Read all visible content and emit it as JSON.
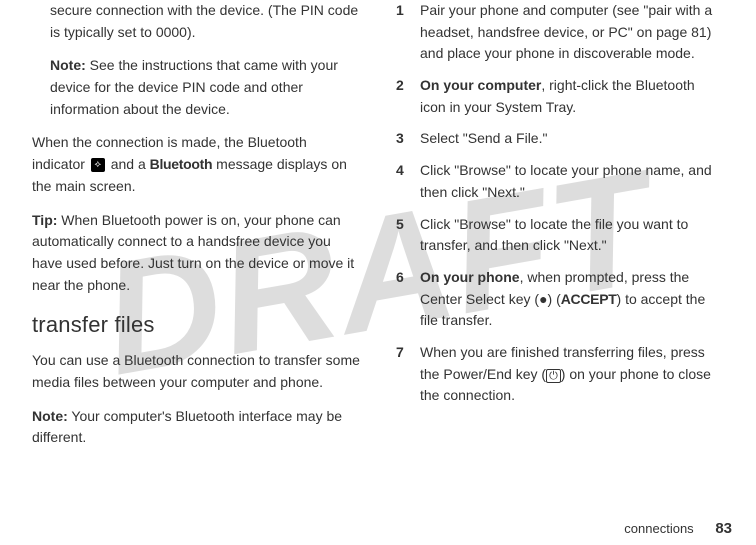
{
  "watermark": "DRAFT",
  "left": {
    "p1a": "secure connection with the device. (The PIN code is typically set to 0000).",
    "note_label": "Note:",
    "p1b": " See the instructions that came with your device for the device PIN code and other information about the device.",
    "p2a": "When the connection is made, the Bluetooth indicator ",
    "bt_icon": "⟡",
    "p2b": " and a ",
    "bt_word": "Bluetooth",
    "p2c": " message displays on the main screen.",
    "tip_label": "Tip:",
    "p3": " When Bluetooth power is on, your phone can automatically connect to a handsfree device you have used before. Just turn on the device or move it near the phone.",
    "section_title": "transfer files",
    "p4": "You can use a Bluetooth connection to transfer some media files between your computer and phone.",
    "note2_label": "Note:",
    "p5": " Your computer's Bluetooth interface may be different."
  },
  "right": {
    "steps": [
      {
        "n": "1",
        "pre": "",
        "bold": "",
        "txt": "Pair your phone and computer (see \"pair with a headset, handsfree device, or PC\" on page 81) and place your phone in discoverable mode."
      },
      {
        "n": "2",
        "pre": "",
        "bold": "On your computer",
        "txt": ", right-click the Bluetooth icon in your System Tray."
      },
      {
        "n": "3",
        "pre": "",
        "bold": "",
        "txt": "Select \"Send a File.\""
      },
      {
        "n": "4",
        "pre": "",
        "bold": "",
        "txt": "Click \"Browse\" to locate your phone name, and then click \"Next.\""
      },
      {
        "n": "5",
        "pre": "",
        "bold": "",
        "txt": "Click \"Browse\" to locate the file you want to transfer, and then click \"Next.\""
      }
    ],
    "step6": {
      "n": "6",
      "bold": "On your phone",
      "txt_a": ", when prompted, press the Center Select key (",
      "key_dot": "●",
      "txt_b": ") (",
      "accept": "ACCEPT",
      "txt_c": ") to accept the file transfer."
    },
    "step7": {
      "n": "7",
      "txt_a": "When you are finished transferring files, press the Power/End key (",
      "key_pwr": "⏻",
      "txt_b": ") on your phone to close the connection."
    }
  },
  "footer": {
    "section": "connections",
    "page": "83"
  }
}
